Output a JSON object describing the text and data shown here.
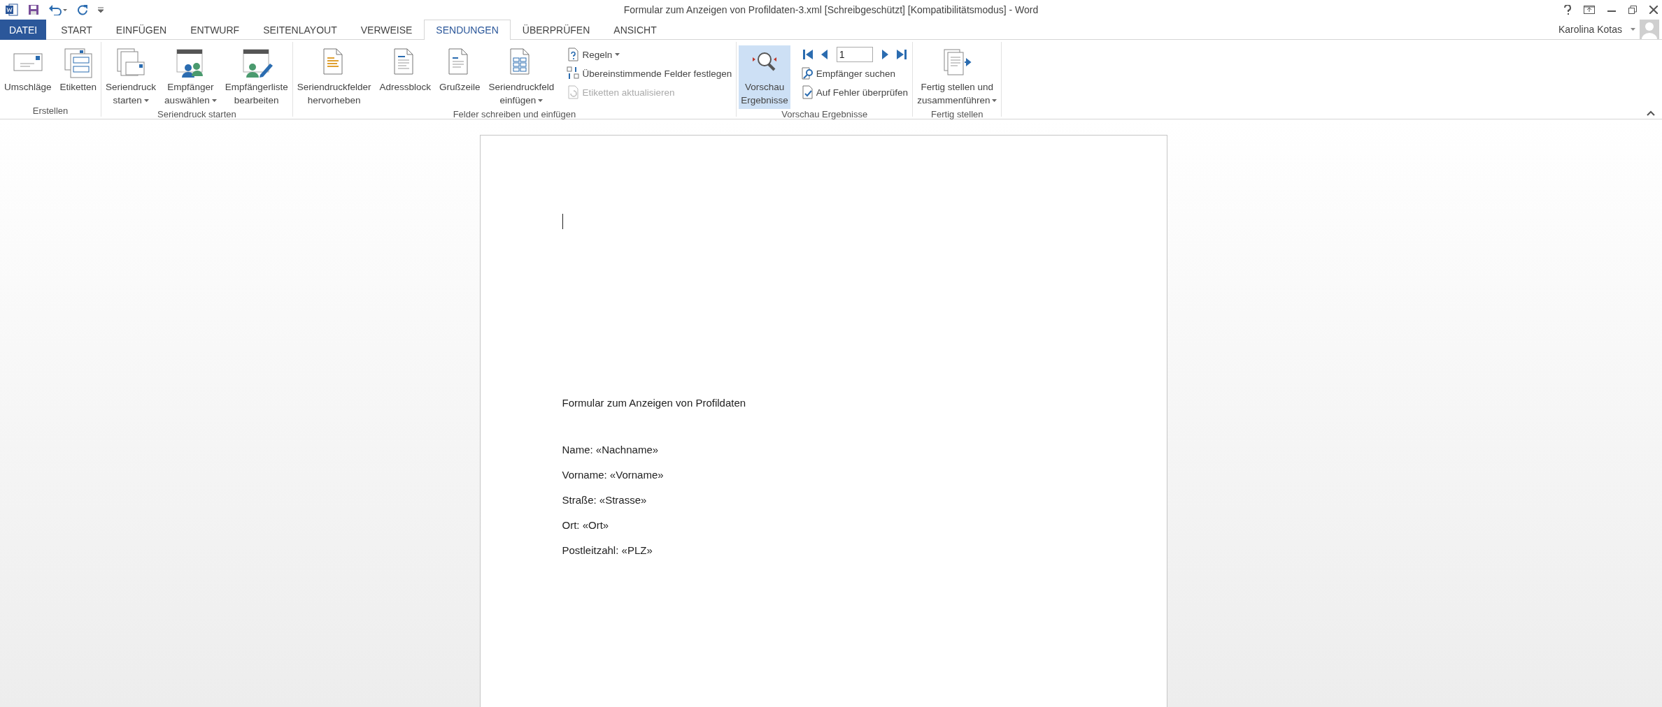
{
  "window": {
    "title": "Formular zum Anzeigen von Profildaten-3.xml [Schreibgeschützt] [Kompatibilitätsmodus] - Word"
  },
  "tabs": [
    {
      "label": "DATEI",
      "kind": "file",
      "selected": false
    },
    {
      "label": "START",
      "kind": "tab",
      "selected": false
    },
    {
      "label": "EINFÜGEN",
      "kind": "tab",
      "selected": false
    },
    {
      "label": "ENTWURF",
      "kind": "tab",
      "selected": false
    },
    {
      "label": "SEITENLAYOUT",
      "kind": "tab",
      "selected": false
    },
    {
      "label": "VERWEISE",
      "kind": "tab",
      "selected": false
    },
    {
      "label": "SENDUNGEN",
      "kind": "tab",
      "selected": true
    },
    {
      "label": "ÜBERPRÜFEN",
      "kind": "tab",
      "selected": false
    },
    {
      "label": "ANSICHT",
      "kind": "tab",
      "selected": false
    }
  ],
  "account": {
    "name": "Karolina Kotas"
  },
  "ribbon": {
    "groups": [
      {
        "label": "Erstellen",
        "items": [
          {
            "kind": "large",
            "lines": [
              "Umschläge"
            ],
            "dropdown": false,
            "selected": false
          },
          {
            "kind": "large",
            "lines": [
              "Etiketten"
            ],
            "dropdown": false,
            "selected": false
          }
        ]
      },
      {
        "label": "Seriendruck starten",
        "items": [
          {
            "kind": "large",
            "lines": [
              "Seriendruck",
              "starten"
            ],
            "dropdown": true,
            "selected": false
          },
          {
            "kind": "large",
            "lines": [
              "Empfänger",
              "auswählen"
            ],
            "dropdown": true,
            "selected": false
          },
          {
            "kind": "large",
            "lines": [
              "Empfängerliste",
              "bearbeiten"
            ],
            "dropdown": false,
            "selected": false
          }
        ]
      },
      {
        "label": "Felder schreiben und einfügen",
        "items": [
          {
            "kind": "large",
            "lines": [
              "Seriendruckfelder",
              "hervorheben"
            ],
            "dropdown": false,
            "selected": false
          },
          {
            "kind": "large",
            "lines": [
              "Adressblock"
            ],
            "dropdown": false,
            "selected": false
          },
          {
            "kind": "large",
            "lines": [
              "Grußzeile"
            ],
            "dropdown": false,
            "selected": false
          },
          {
            "kind": "large",
            "lines": [
              "Seriendruckfeld",
              "einfügen"
            ],
            "dropdown": true,
            "selected": false
          },
          {
            "kind": "stack",
            "rows": [
              {
                "label": "Regeln",
                "dropdown": true,
                "disabled": false
              },
              {
                "label": "Übereinstimmende Felder festlegen",
                "dropdown": false,
                "disabled": false
              },
              {
                "label": "Etiketten aktualisieren",
                "dropdown": false,
                "disabled": true
              }
            ]
          }
        ]
      },
      {
        "label": "Vorschau Ergebnisse",
        "items": [
          {
            "kind": "large",
            "lines": [
              "Vorschau",
              "Ergebnisse"
            ],
            "dropdown": false,
            "selected": true
          },
          {
            "kind": "nav",
            "record": "1",
            "rows": [
              {
                "label": "Empfänger suchen",
                "dropdown": false,
                "disabled": false
              },
              {
                "label": "Auf Fehler überprüfen",
                "dropdown": false,
                "disabled": false
              }
            ]
          }
        ]
      },
      {
        "label": "Fertig stellen",
        "items": [
          {
            "kind": "large",
            "lines": [
              "Fertig stellen und",
              "zusammenführen"
            ],
            "dropdown": true,
            "selected": false
          }
        ]
      }
    ]
  },
  "document": {
    "heading": "Formular zum Anzeigen von Profildaten",
    "lines": [
      "Name: «Nachname»",
      "Vorname: «Vorname»",
      "Straße: «Strasse»",
      "Ort: «Ort»",
      "Postleitzahl: «PLZ»"
    ]
  }
}
